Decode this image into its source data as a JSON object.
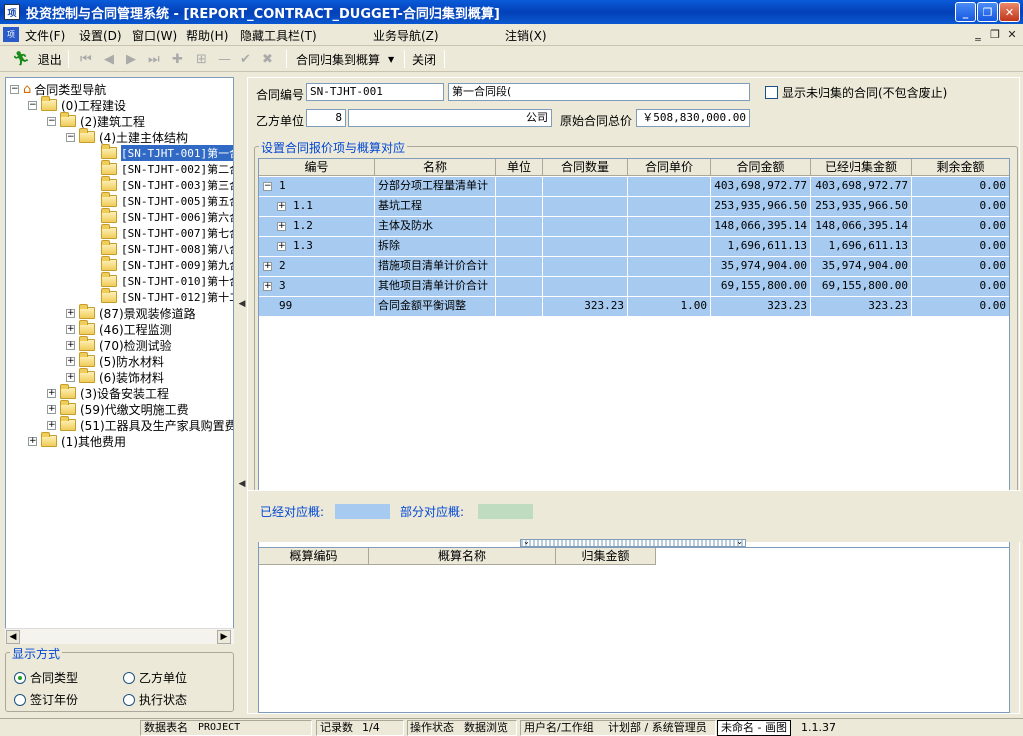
{
  "window": {
    "title": "投资控制与合同管理系统 - [REPORT_CONTRACT_DUGGET-合同归集到概算]",
    "app_icon": "项"
  },
  "menu": [
    {
      "label": "文件(F)"
    },
    {
      "label": "设置(D)"
    },
    {
      "label": "窗口(W)"
    },
    {
      "label": "帮助(H)"
    },
    {
      "label": "隐藏工具栏(T)"
    },
    {
      "label": "业务导航(Z)"
    },
    {
      "label": "注销(X)"
    }
  ],
  "toolbar": {
    "exit_label": "退出",
    "collect_label": "合同归集到概算",
    "close_label": "关闭"
  },
  "tree": {
    "root": "合同类型导航",
    "n0": "(0)工程建设",
    "n1": "(2)建筑工程",
    "n2": "(4)土建主体结构",
    "contracts": [
      "[SN-TJHT-001]第一合",
      "[SN-TJHT-002]第二合",
      "[SN-TJHT-003]第三合",
      "[SN-TJHT-005]第五合",
      "[SN-TJHT-006]第六合",
      "[SN-TJHT-007]第七合",
      "[SN-TJHT-008]第八合",
      "[SN-TJHT-009]第九合",
      "[SN-TJHT-010]第十合",
      "[SN-TJHT-012]第十二"
    ],
    "siblings2": [
      "(87)景观装修道路",
      "(46)工程监测",
      "(70)检测试验",
      "(5)防水材料",
      "(6)装饰材料"
    ],
    "siblings1": [
      "(3)设备安装工程",
      "(59)代缴文明施工费",
      "(51)工器具及生产家具购置费"
    ],
    "other": "(1)其他费用"
  },
  "display": {
    "legend": "显示方式",
    "options": [
      "合同类型",
      "乙方单位",
      "签订年份",
      "执行状态"
    ],
    "selected": "合同类型"
  },
  "form": {
    "contract_no_label": "合同编号",
    "contract_no": "SN-TJHT-001",
    "contract_name": "第一合同段(",
    "show_uncollected_label": "显示未归集的合同(不包含废止)",
    "party_b_label": "乙方单位",
    "party_b_code": "8",
    "party_b_name": "公司",
    "total_label": "原始合同总价",
    "total_value": "￥508,830,000.00"
  },
  "mapping": {
    "legend": "设置合同报价项与概算对应",
    "columns": [
      "编号",
      "名称",
      "单位",
      "合同数量",
      "合同单价",
      "合同金额",
      "已经归集金额",
      "剩余金额"
    ],
    "rows": [
      {
        "code": "1",
        "name": "分部分项工程量清单计",
        "unit": "",
        "qty": "",
        "price": "",
        "amount": "403,698,972.77",
        "collected": "403,698,972.77",
        "remain": "0.00",
        "level": 0,
        "exp": "-"
      },
      {
        "code": "1.1",
        "name": "基坑工程",
        "unit": "",
        "qty": "",
        "price": "",
        "amount": "253,935,966.50",
        "collected": "253,935,966.50",
        "remain": "0.00",
        "level": 1,
        "exp": "+"
      },
      {
        "code": "1.2",
        "name": "主体及防水",
        "unit": "",
        "qty": "",
        "price": "",
        "amount": "148,066,395.14",
        "collected": "148,066,395.14",
        "remain": "0.00",
        "level": 1,
        "exp": "+"
      },
      {
        "code": "1.3",
        "name": "拆除",
        "unit": "",
        "qty": "",
        "price": "",
        "amount": "1,696,611.13",
        "collected": "1,696,611.13",
        "remain": "0.00",
        "level": 1,
        "exp": "+"
      },
      {
        "code": "2",
        "name": "措施项目清单计价合计",
        "unit": "",
        "qty": "",
        "price": "",
        "amount": "35,974,904.00",
        "collected": "35,974,904.00",
        "remain": "0.00",
        "level": 0,
        "exp": "+"
      },
      {
        "code": "3",
        "name": "其他项目清单计价合计",
        "unit": "",
        "qty": "",
        "price": "",
        "amount": "69,155,800.00",
        "collected": "69,155,800.00",
        "remain": "0.00",
        "level": 0,
        "exp": "+"
      },
      {
        "code": "99",
        "name": "合同金额平衡调整",
        "unit": "",
        "qty": "323.23",
        "price": "1.00",
        "amount": "323.23",
        "collected": "323.23",
        "remain": "0.00",
        "level": 0,
        "exp": ""
      }
    ]
  },
  "legend_bar": {
    "mapped_label": "已经对应概:",
    "partial_label": "部分对应概:",
    "mapped_color": "#a6caf0",
    "partial_color": "#c0dcc0"
  },
  "budget": {
    "columns": [
      "概算编码",
      "概算名称",
      "归集金额"
    ]
  },
  "status": {
    "table_label": "数据表名",
    "table_value": "PROJECT",
    "count_label": "记录数",
    "count_value": "1/4",
    "op_label": "操作状态",
    "op_value": "数据浏览",
    "user_label": "用户名/工作组",
    "user_value": "计划部 / 系统管理员",
    "popup": "未命名 - 画图",
    "version": "1.1.37"
  }
}
